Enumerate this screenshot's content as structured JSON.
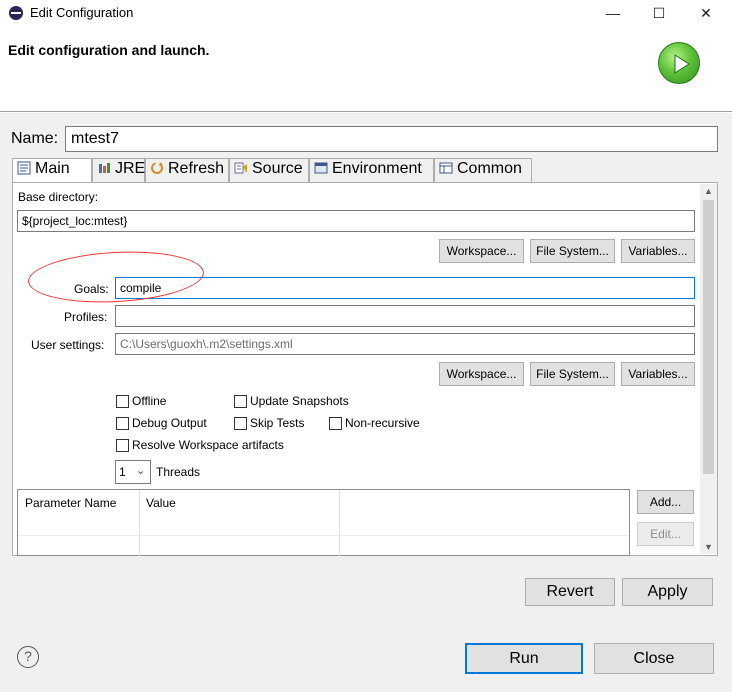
{
  "window": {
    "title": "Edit Configuration",
    "minimize": "—",
    "maximize": "☐",
    "close": "✕"
  },
  "header": {
    "heading": "Edit configuration and launch.",
    "icon": "run-icon"
  },
  "name": {
    "label": "Name:",
    "value": "mtest7"
  },
  "tabs": [
    {
      "label": "Main",
      "icon": "main-tab-icon",
      "active": true
    },
    {
      "label": "JRE",
      "icon": "jre-icon"
    },
    {
      "label": "Refresh",
      "icon": "refresh-icon"
    },
    {
      "label": "Source",
      "icon": "source-icon"
    },
    {
      "label": "Environment",
      "icon": "environment-icon"
    },
    {
      "label": "Common",
      "icon": "common-icon"
    }
  ],
  "main": {
    "base_dir_label": "Base directory:",
    "base_dir_value": "${project_loc:mtest}",
    "workspace_btn": "Workspace...",
    "filesystem_btn": "File System...",
    "variables_btn": "Variables...",
    "goals_label": "Goals:",
    "goals_value": "compile",
    "profiles_label": "Profiles:",
    "profiles_value": "",
    "user_settings_label": "User settings:",
    "user_settings_value": "C:\\Users\\guoxh\\.m2\\settings.xml",
    "checkboxes": {
      "offline": "Offline",
      "update_snapshots": "Update Snapshots",
      "debug_output": "Debug Output",
      "skip_tests": "Skip Tests",
      "non_recursive": "Non-recursive",
      "resolve_workspace": "Resolve Workspace artifacts"
    },
    "threads_value": "1",
    "threads_label": "Threads",
    "params_table": {
      "columns": [
        "Parameter Name",
        "Value"
      ]
    },
    "add_btn": "Add...",
    "edit_btn": "Edit..."
  },
  "footer": {
    "revert": "Revert",
    "apply": "Apply",
    "run": "Run",
    "close": "Close",
    "help": "?"
  },
  "annotation_color": "#e33333",
  "accent": "#0078d7"
}
